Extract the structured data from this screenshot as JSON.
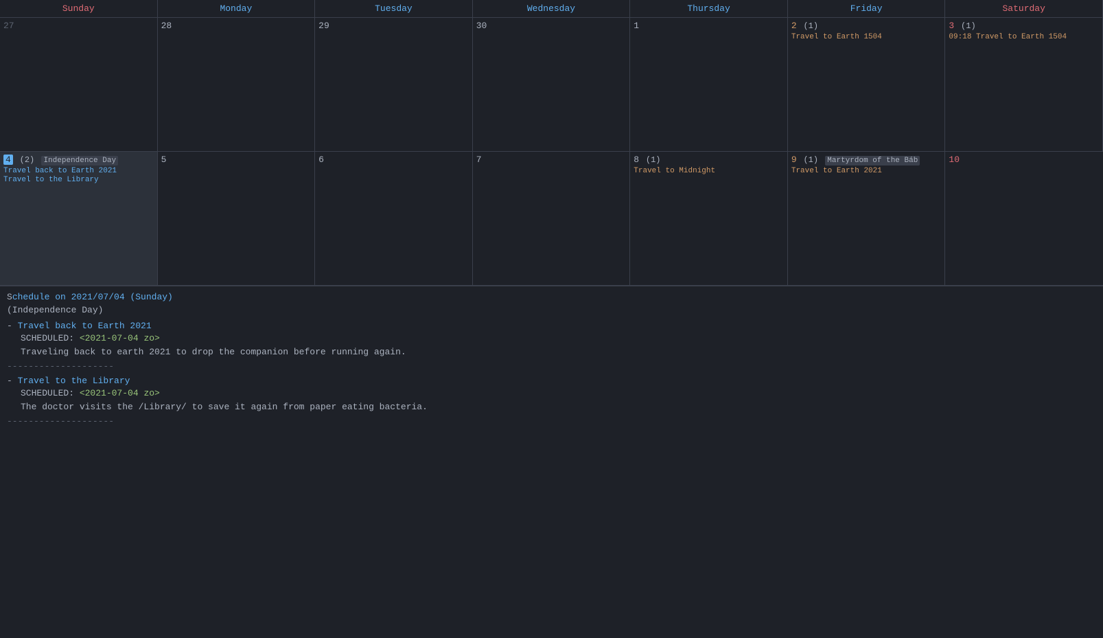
{
  "calendar": {
    "headers": [
      {
        "label": "Sunday",
        "class": "sun"
      },
      {
        "label": "Monday",
        "class": "mon"
      },
      {
        "label": "Tuesday",
        "class": "tue"
      },
      {
        "label": "Wednesday",
        "class": "wed"
      },
      {
        "label": "Thursday",
        "class": "thu"
      },
      {
        "label": "Friday",
        "class": "fri"
      },
      {
        "label": "Saturday",
        "class": "sat"
      }
    ],
    "weeks": [
      [
        {
          "num": "27",
          "numClass": "gray",
          "events": []
        },
        {
          "num": "28",
          "numClass": "normal",
          "events": []
        },
        {
          "num": "29",
          "numClass": "normal",
          "events": []
        },
        {
          "num": "30",
          "numClass": "normal",
          "events": []
        },
        {
          "num": "1",
          "numClass": "normal",
          "events": []
        },
        {
          "num": "2",
          "numClass": "orange",
          "count": "(1)",
          "events": [
            {
              "text": "Travel to Earth 1504",
              "color": "orange"
            }
          ]
        },
        {
          "num": "3",
          "numClass": "red",
          "count": "(1)",
          "events": [
            {
              "text": "09:18 Travel to Earth 1504",
              "color": "orange"
            }
          ]
        }
      ],
      [
        {
          "num": "4",
          "numClass": "selected",
          "holiday": "Independence Day",
          "count": "(2)",
          "selected": true,
          "events": [
            {
              "text": "Travel back to Earth 2021",
              "color": "blue"
            },
            {
              "text": "Travel to the Library",
              "color": "blue"
            }
          ]
        },
        {
          "num": "5",
          "numClass": "normal",
          "events": []
        },
        {
          "num": "6",
          "numClass": "normal",
          "events": []
        },
        {
          "num": "7",
          "numClass": "normal",
          "events": []
        },
        {
          "num": "8",
          "numClass": "normal",
          "count": "(1)",
          "events": [
            {
              "text": "Travel to Midnight",
              "color": "orange"
            }
          ]
        },
        {
          "num": "9",
          "numClass": "orange",
          "count": "(1)",
          "holiday": "Martyrdom of the Báb",
          "events": [
            {
              "text": "Travel to Earth 2021",
              "color": "orange"
            }
          ]
        },
        {
          "num": "10",
          "numClass": "red",
          "events": []
        }
      ]
    ]
  },
  "schedule": {
    "header_date": "2021/07/04",
    "header_day": "Sunday",
    "holiday_name": "Independence Day",
    "entries": [
      {
        "title": "Travel back to Earth 2021",
        "scheduled_label": "SCHEDULED:",
        "scheduled_value": "<2021-07-04 zo>",
        "description": "Traveling back to earth 2021 to drop the companion before running again."
      },
      {
        "title": "Travel to the Library",
        "scheduled_label": "SCHEDULED:",
        "scheduled_value": "<2021-07-04 zo>",
        "description": "The doctor visits the /Library/ to save it again from paper eating bacteria."
      }
    ],
    "separator": "--------------------"
  }
}
